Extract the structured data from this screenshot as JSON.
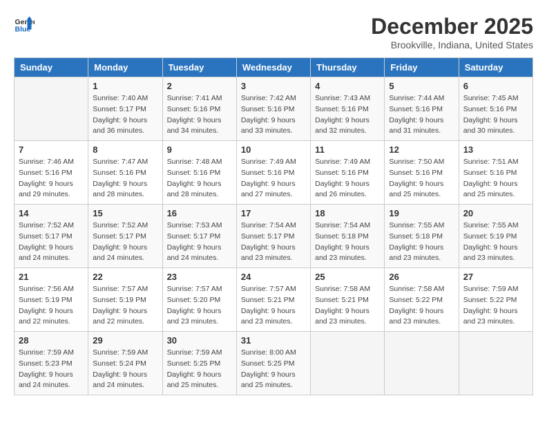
{
  "header": {
    "logo_general": "General",
    "logo_blue": "Blue",
    "month_year": "December 2025",
    "location": "Brookville, Indiana, United States"
  },
  "days_of_week": [
    "Sunday",
    "Monday",
    "Tuesday",
    "Wednesday",
    "Thursday",
    "Friday",
    "Saturday"
  ],
  "weeks": [
    [
      {
        "day": "",
        "info": ""
      },
      {
        "day": "1",
        "info": "Sunrise: 7:40 AM\nSunset: 5:17 PM\nDaylight: 9 hours\nand 36 minutes."
      },
      {
        "day": "2",
        "info": "Sunrise: 7:41 AM\nSunset: 5:16 PM\nDaylight: 9 hours\nand 34 minutes."
      },
      {
        "day": "3",
        "info": "Sunrise: 7:42 AM\nSunset: 5:16 PM\nDaylight: 9 hours\nand 33 minutes."
      },
      {
        "day": "4",
        "info": "Sunrise: 7:43 AM\nSunset: 5:16 PM\nDaylight: 9 hours\nand 32 minutes."
      },
      {
        "day": "5",
        "info": "Sunrise: 7:44 AM\nSunset: 5:16 PM\nDaylight: 9 hours\nand 31 minutes."
      },
      {
        "day": "6",
        "info": "Sunrise: 7:45 AM\nSunset: 5:16 PM\nDaylight: 9 hours\nand 30 minutes."
      }
    ],
    [
      {
        "day": "7",
        "info": "Sunrise: 7:46 AM\nSunset: 5:16 PM\nDaylight: 9 hours\nand 29 minutes."
      },
      {
        "day": "8",
        "info": "Sunrise: 7:47 AM\nSunset: 5:16 PM\nDaylight: 9 hours\nand 28 minutes."
      },
      {
        "day": "9",
        "info": "Sunrise: 7:48 AM\nSunset: 5:16 PM\nDaylight: 9 hours\nand 28 minutes."
      },
      {
        "day": "10",
        "info": "Sunrise: 7:49 AM\nSunset: 5:16 PM\nDaylight: 9 hours\nand 27 minutes."
      },
      {
        "day": "11",
        "info": "Sunrise: 7:49 AM\nSunset: 5:16 PM\nDaylight: 9 hours\nand 26 minutes."
      },
      {
        "day": "12",
        "info": "Sunrise: 7:50 AM\nSunset: 5:16 PM\nDaylight: 9 hours\nand 25 minutes."
      },
      {
        "day": "13",
        "info": "Sunrise: 7:51 AM\nSunset: 5:16 PM\nDaylight: 9 hours\nand 25 minutes."
      }
    ],
    [
      {
        "day": "14",
        "info": "Sunrise: 7:52 AM\nSunset: 5:17 PM\nDaylight: 9 hours\nand 24 minutes."
      },
      {
        "day": "15",
        "info": "Sunrise: 7:52 AM\nSunset: 5:17 PM\nDaylight: 9 hours\nand 24 minutes."
      },
      {
        "day": "16",
        "info": "Sunrise: 7:53 AM\nSunset: 5:17 PM\nDaylight: 9 hours\nand 24 minutes."
      },
      {
        "day": "17",
        "info": "Sunrise: 7:54 AM\nSunset: 5:17 PM\nDaylight: 9 hours\nand 23 minutes."
      },
      {
        "day": "18",
        "info": "Sunrise: 7:54 AM\nSunset: 5:18 PM\nDaylight: 9 hours\nand 23 minutes."
      },
      {
        "day": "19",
        "info": "Sunrise: 7:55 AM\nSunset: 5:18 PM\nDaylight: 9 hours\nand 23 minutes."
      },
      {
        "day": "20",
        "info": "Sunrise: 7:55 AM\nSunset: 5:19 PM\nDaylight: 9 hours\nand 23 minutes."
      }
    ],
    [
      {
        "day": "21",
        "info": "Sunrise: 7:56 AM\nSunset: 5:19 PM\nDaylight: 9 hours\nand 22 minutes."
      },
      {
        "day": "22",
        "info": "Sunrise: 7:57 AM\nSunset: 5:19 PM\nDaylight: 9 hours\nand 22 minutes."
      },
      {
        "day": "23",
        "info": "Sunrise: 7:57 AM\nSunset: 5:20 PM\nDaylight: 9 hours\nand 23 minutes."
      },
      {
        "day": "24",
        "info": "Sunrise: 7:57 AM\nSunset: 5:21 PM\nDaylight: 9 hours\nand 23 minutes."
      },
      {
        "day": "25",
        "info": "Sunrise: 7:58 AM\nSunset: 5:21 PM\nDaylight: 9 hours\nand 23 minutes."
      },
      {
        "day": "26",
        "info": "Sunrise: 7:58 AM\nSunset: 5:22 PM\nDaylight: 9 hours\nand 23 minutes."
      },
      {
        "day": "27",
        "info": "Sunrise: 7:59 AM\nSunset: 5:22 PM\nDaylight: 9 hours\nand 23 minutes."
      }
    ],
    [
      {
        "day": "28",
        "info": "Sunrise: 7:59 AM\nSunset: 5:23 PM\nDaylight: 9 hours\nand 24 minutes."
      },
      {
        "day": "29",
        "info": "Sunrise: 7:59 AM\nSunset: 5:24 PM\nDaylight: 9 hours\nand 24 minutes."
      },
      {
        "day": "30",
        "info": "Sunrise: 7:59 AM\nSunset: 5:25 PM\nDaylight: 9 hours\nand 25 minutes."
      },
      {
        "day": "31",
        "info": "Sunrise: 8:00 AM\nSunset: 5:25 PM\nDaylight: 9 hours\nand 25 minutes."
      },
      {
        "day": "",
        "info": ""
      },
      {
        "day": "",
        "info": ""
      },
      {
        "day": "",
        "info": ""
      }
    ]
  ]
}
